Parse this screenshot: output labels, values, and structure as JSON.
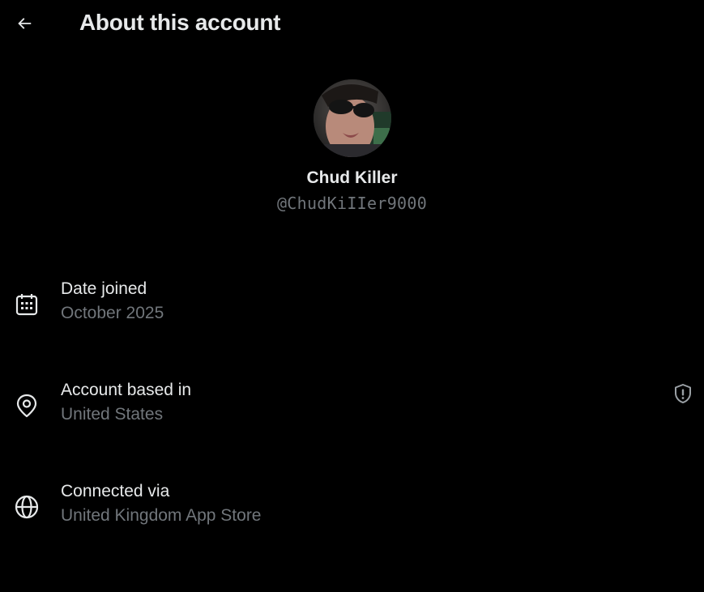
{
  "header": {
    "title": "About this account",
    "back_icon": "arrow-left-icon"
  },
  "profile": {
    "display_name": "Chud Killer",
    "handle": "@ChudKiIIer9000",
    "avatar_icon": "profile-photo"
  },
  "details": [
    {
      "icon": "calendar-icon",
      "label": "Date joined",
      "value": "October 2025"
    },
    {
      "icon": "location-pin-icon",
      "label": "Account based in",
      "value": "United States",
      "trailing_icon": "shield-alert-icon"
    },
    {
      "icon": "globe-icon",
      "label": "Connected via",
      "value": "United Kingdom App Store"
    }
  ],
  "colors": {
    "background": "#000000",
    "primary_text": "#e7e9ea",
    "secondary_text": "#71767b"
  }
}
